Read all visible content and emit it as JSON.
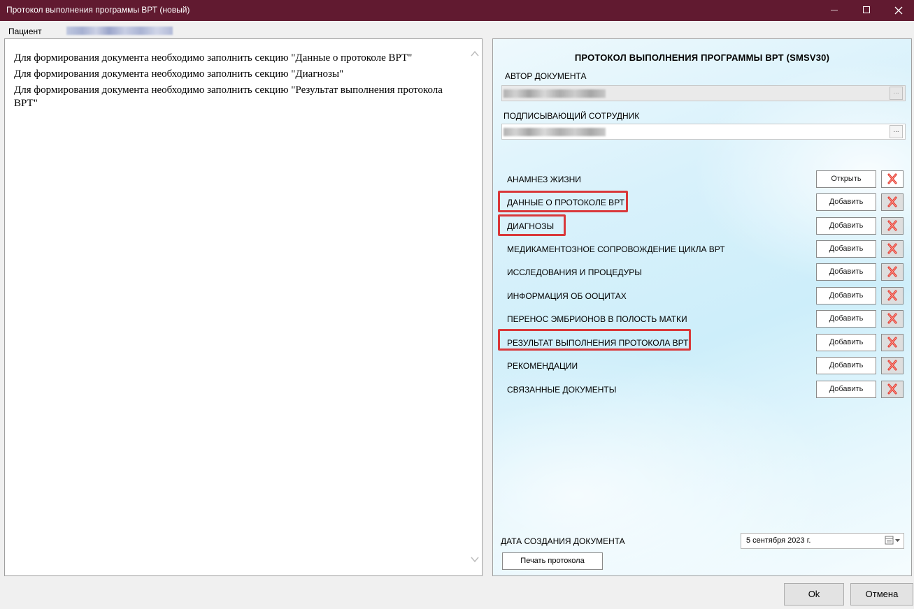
{
  "window": {
    "title": "Протокол выполнения программы ВРТ (новый)"
  },
  "patient": {
    "label": "Пациент"
  },
  "messages": [
    "Для формирования документа необходимо заполнить секцию \"Данные о протоколе ВРТ\"",
    "Для формирования документа необходимо заполнить секцию \"Диагнозы\"",
    "Для формирования документа необходимо заполнить секцию \"Результат выполнения протокола ВРТ\""
  ],
  "form": {
    "heading": "ПРОТОКОЛ ВЫПОЛНЕНИЯ ПРОГРАММЫ ВРТ (SMSV30)",
    "author_label": "АВТОР ДОКУМЕНТА",
    "signer_label": "ПОДПИСЫВАЮЩИЙ СОТРУДНИК",
    "dots": "...",
    "sections": [
      {
        "label": "АНАМНЕЗ ЖИЗНИ",
        "action": "Открыть",
        "highlighted": false,
        "delete_enabled": true
      },
      {
        "label": "ДАННЫЕ О ПРОТОКОЛЕ ВРТ",
        "action": "Добавить",
        "highlighted": true,
        "delete_enabled": false
      },
      {
        "label": "ДИАГНОЗЫ",
        "action": "Добавить",
        "highlighted": true,
        "delete_enabled": false
      },
      {
        "label": "МЕДИКАМЕНТОЗНОЕ СОПРОВОЖДЕНИЕ ЦИКЛА ВРТ",
        "action": "Добавить",
        "highlighted": false,
        "delete_enabled": false
      },
      {
        "label": "ИССЛЕДОВАНИЯ И ПРОЦЕДУРЫ",
        "action": "Добавить",
        "highlighted": false,
        "delete_enabled": false
      },
      {
        "label": "ИНФОРМАЦИЯ ОБ ООЦИТАХ",
        "action": "Добавить",
        "highlighted": false,
        "delete_enabled": false
      },
      {
        "label": "ПЕРЕНОС ЭМБРИОНОВ В ПОЛОСТЬ МАТКИ",
        "action": "Добавить",
        "highlighted": false,
        "delete_enabled": false
      },
      {
        "label": "РЕЗУЛЬТАТ ВЫПОЛНЕНИЯ ПРОТОКОЛА ВРТ",
        "action": "Добавить",
        "highlighted": true,
        "delete_enabled": false
      },
      {
        "label": "РЕКОМЕНДАЦИИ",
        "action": "Добавить",
        "highlighted": false,
        "delete_enabled": false
      },
      {
        "label": "СВЯЗАННЫЕ ДОКУМЕНТЫ",
        "action": "Добавить",
        "highlighted": false,
        "delete_enabled": false
      }
    ],
    "date_label": "ДАТА СОЗДАНИЯ ДОКУМЕНТА",
    "date_value": "5 сентября 2023 г.",
    "print_label": "Печать протокола"
  },
  "dialog": {
    "ok_label": "Ok",
    "cancel_label": "Отмена"
  },
  "colors": {
    "titlebar": "#611a30",
    "highlight": "#d9383a",
    "delete_icon": "#e0352b"
  }
}
